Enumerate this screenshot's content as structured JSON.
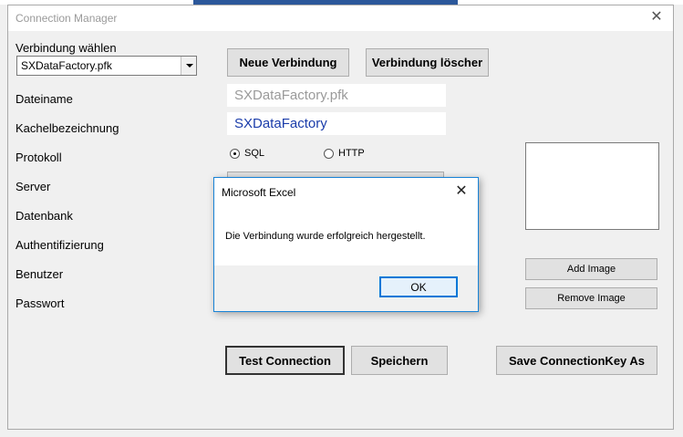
{
  "window": {
    "title": "Connection Manager",
    "close_glyph": "✕"
  },
  "form": {
    "select_label": "Verbindung wählen",
    "select_value": "SXDataFactory.pfk",
    "labels": {
      "dateiname": "Dateiname",
      "kachelbezeichnung": "Kachelbezeichnung",
      "protokoll": "Protokoll",
      "server": "Server",
      "datenbank": "Datenbank",
      "authentifizierung": "Authentifizierung",
      "benutzer": "Benutzer",
      "passwort": "Passwort"
    },
    "dateiname_value": "SXDataFactory.pfk",
    "kachel_value": "SXDataFactory",
    "protocol_options": [
      "SQL",
      "HTTP"
    ],
    "protocol_selected": "SQL"
  },
  "buttons": {
    "neue_verbindung": "Neue Verbindung",
    "verbindung_loeschen": "Verbindung löscher",
    "add_image": "Add Image",
    "remove_image": "Remove Image",
    "test_connection": "Test Connection",
    "speichern": "Speichern",
    "save_connection_key": "Save ConnectionKey As"
  },
  "dialog": {
    "title": "Microsoft Excel",
    "message": "Die Verbindung wurde erfolgreich hergestellt.",
    "ok": "OK",
    "close_glyph": "✕"
  },
  "colors": {
    "kachel_text": "#1a3caa",
    "dateiname_text": "#9a9a9a",
    "dialog_border": "#1883d7",
    "ok_border": "#0078d7"
  }
}
